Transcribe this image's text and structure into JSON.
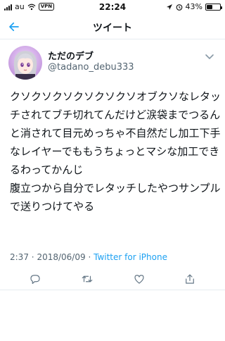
{
  "status_bar": {
    "carrier": "au",
    "vpn": "VPN",
    "time": "22:24",
    "battery_text": "43%",
    "battery_level": 0.43
  },
  "header": {
    "title": "ツイート",
    "back_icon": "arrow-left-icon"
  },
  "tweet": {
    "author_name": "ただのデブ",
    "author_handle": "@tadano_debu333",
    "text": "クソクソクソクソクソクソオブクソなレタッチされてブチ切れてんだけど涙袋までつるんと消されて目元めっちゃ不自然だし加工下手なレイヤーでももうちょっとマシな加工できるわってかんじ\n腹立つから自分でレタッチしたやつサンプルで送りつけてやる",
    "time": "2:37",
    "separator": "·",
    "date": "2018/06/09",
    "source": "Twitter for iPhone"
  },
  "actions": {
    "reply": "reply-icon",
    "retweet": "retweet-icon",
    "like": "heart-icon",
    "share": "share-icon"
  },
  "colors": {
    "accent": "#1da1f2",
    "secondary_text": "#536471",
    "divider": "#e6ecf0"
  }
}
